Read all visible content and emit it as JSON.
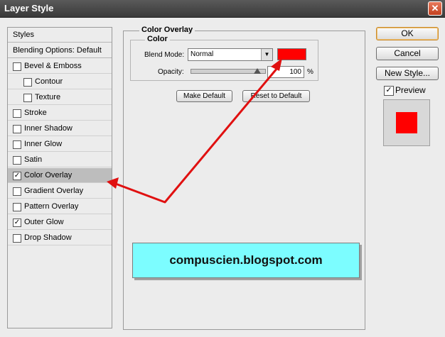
{
  "window": {
    "title": "Layer Style",
    "close_glyph": "✕"
  },
  "styles": {
    "header": "Styles",
    "blending": "Blending Options: Default",
    "items": [
      {
        "label": "Bevel & Emboss",
        "checked": false,
        "indent": false
      },
      {
        "label": "Contour",
        "checked": false,
        "indent": true
      },
      {
        "label": "Texture",
        "checked": false,
        "indent": true
      },
      {
        "label": "Stroke",
        "checked": false,
        "indent": false
      },
      {
        "label": "Inner Shadow",
        "checked": false,
        "indent": false
      },
      {
        "label": "Inner Glow",
        "checked": false,
        "indent": false
      },
      {
        "label": "Satin",
        "checked": false,
        "indent": false
      },
      {
        "label": "Color Overlay",
        "checked": true,
        "indent": false,
        "selected": true
      },
      {
        "label": "Gradient Overlay",
        "checked": false,
        "indent": false
      },
      {
        "label": "Pattern Overlay",
        "checked": false,
        "indent": false
      },
      {
        "label": "Outer Glow",
        "checked": true,
        "indent": false
      },
      {
        "label": "Drop Shadow",
        "checked": false,
        "indent": false
      }
    ]
  },
  "overlay": {
    "section_title": "Color Overlay",
    "group_title": "Color",
    "blend_mode_label": "Blend Mode:",
    "blend_mode_value": "Normal",
    "opacity_label": "Opacity:",
    "opacity_value": "100",
    "opacity_unit": "%",
    "opacity_level": 0.9,
    "color": "#ff0000",
    "make_default": "Make Default",
    "reset_default": "Reset to Default"
  },
  "actions": {
    "ok": "OK",
    "cancel": "Cancel",
    "new_style": "New Style...",
    "preview_label": "Preview",
    "preview_checked": true
  },
  "banner": {
    "text": "compuscien.blogspot.com"
  },
  "colors": {
    "accent": "#ff0000",
    "banner": "#7cfdff",
    "arrow": "#e01010"
  }
}
